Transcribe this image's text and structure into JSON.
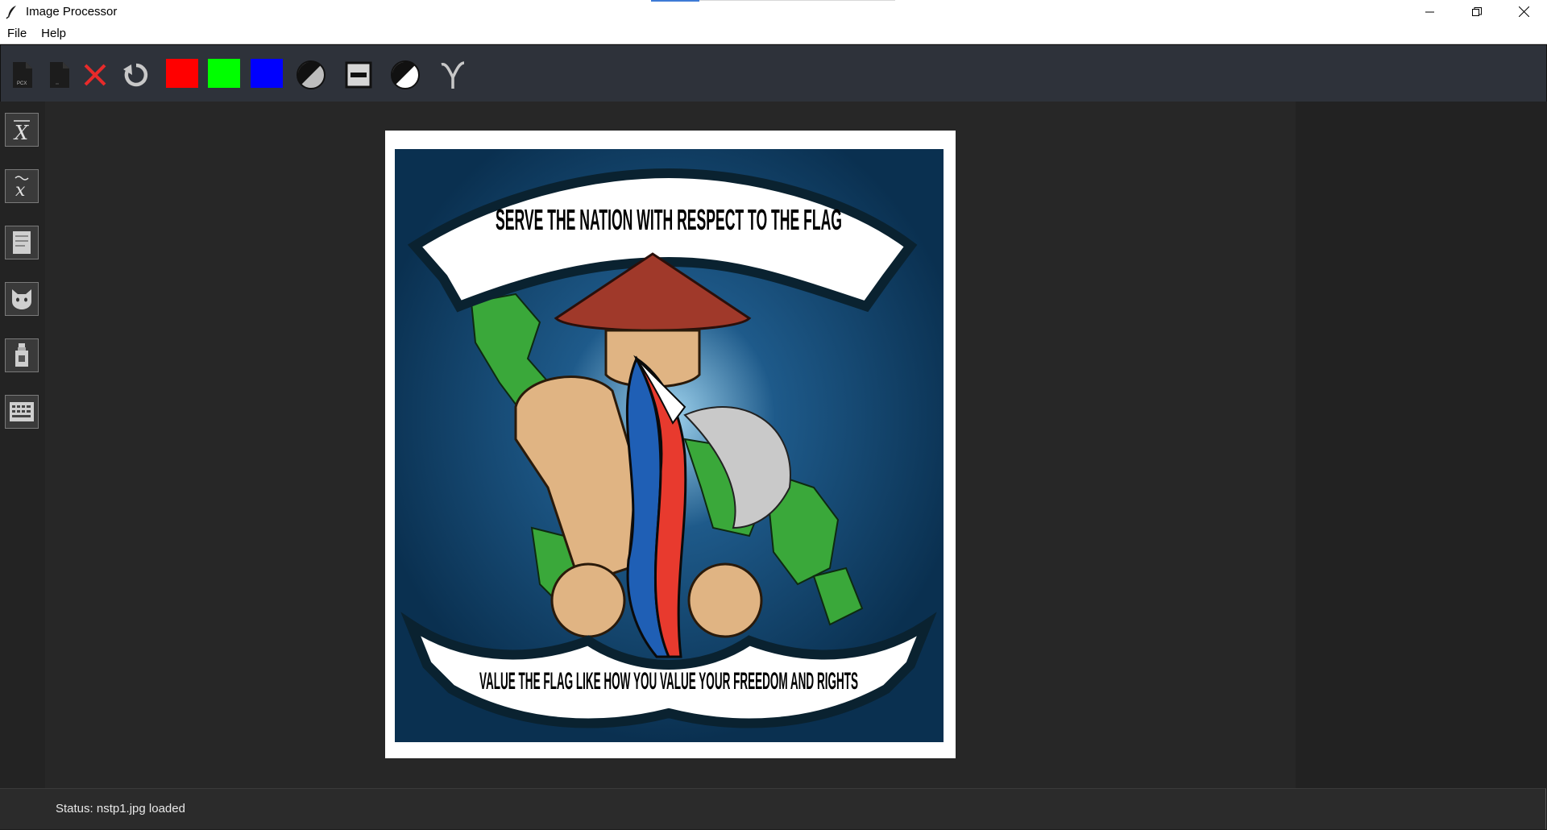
{
  "window": {
    "title": "Image Processor"
  },
  "menu": {
    "items": [
      "File",
      "Help"
    ]
  },
  "toolbar": {
    "icons": [
      "pcx-file-icon",
      "blank-file-icon",
      "close-icon",
      "rotate-icon",
      "grayscale-icon",
      "threshold-icon",
      "negative-icon",
      "gamma-icon"
    ],
    "channel_colors": {
      "red": "#ff0000",
      "green": "#00ff00",
      "blue": "#0000ff"
    },
    "pcx_label": "PCX"
  },
  "sidebar": {
    "icons": [
      "mean-icon",
      "median-icon",
      "document-icon",
      "cat-icon",
      "bottle-icon",
      "keyboard-icon"
    ]
  },
  "image": {
    "top_banner": "SERVE THE NATION WITH RESPECT TO THE FLAG",
    "bottom_banner": "VALUE THE FLAG LIKE HOW YOU VALUE YOUR FREEDOM AND RIGHTS"
  },
  "status": {
    "text": "Status: nstp1.jpg loaded"
  }
}
